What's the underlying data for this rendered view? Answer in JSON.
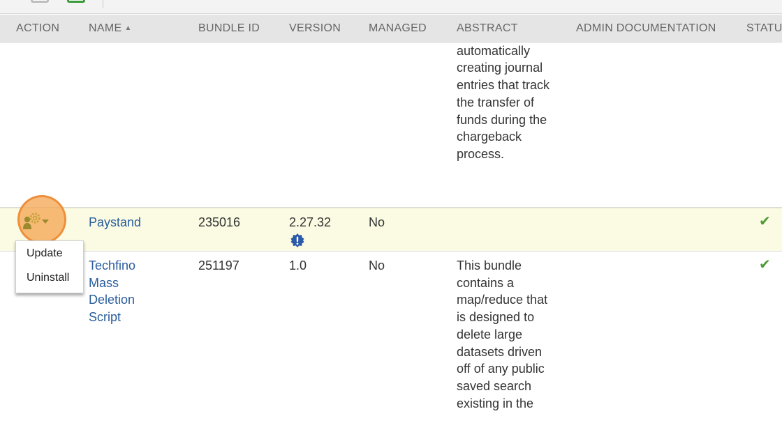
{
  "toolbar": {
    "print_icon": "print-icon",
    "export_icon": "export-excel-icon"
  },
  "columns": {
    "action": "ACTION",
    "name": "NAME",
    "sort_indicator": "▲",
    "bundle_id": "BUNDLE ID",
    "version": "VERSION",
    "managed": "MANAGED",
    "abstract": "ABSTRACT",
    "admin_documentation": "ADMIN DOCUMENTATION",
    "status": "STATUS"
  },
  "rows": [
    {
      "abstract": "payments by automatically creating journal entries that track the transfer of funds during the chargeback process."
    },
    {
      "name": "Paystand",
      "bundle_id": "235016",
      "version": "2.27.32",
      "version_notice_icon": "update-available-icon",
      "managed": "No",
      "abstract": "",
      "status_icon": "checkmark-icon",
      "highlighted": true
    },
    {
      "name": "Techfino Mass Deletion Script",
      "bundle_id": "251197",
      "version": "1.0",
      "managed": "No",
      "abstract": "This bundle contains a map/reduce that is designed to delete large datasets driven off of any public saved search existing in the",
      "status_icon": "checkmark-icon"
    }
  ],
  "action_menu": {
    "items": [
      "Update",
      "Uninstall"
    ]
  },
  "colors": {
    "link": "#2a5d9c",
    "highlight_row": "#fbfbe4",
    "status_check": "#4e9a33",
    "click_indicator": "#f5a856"
  }
}
